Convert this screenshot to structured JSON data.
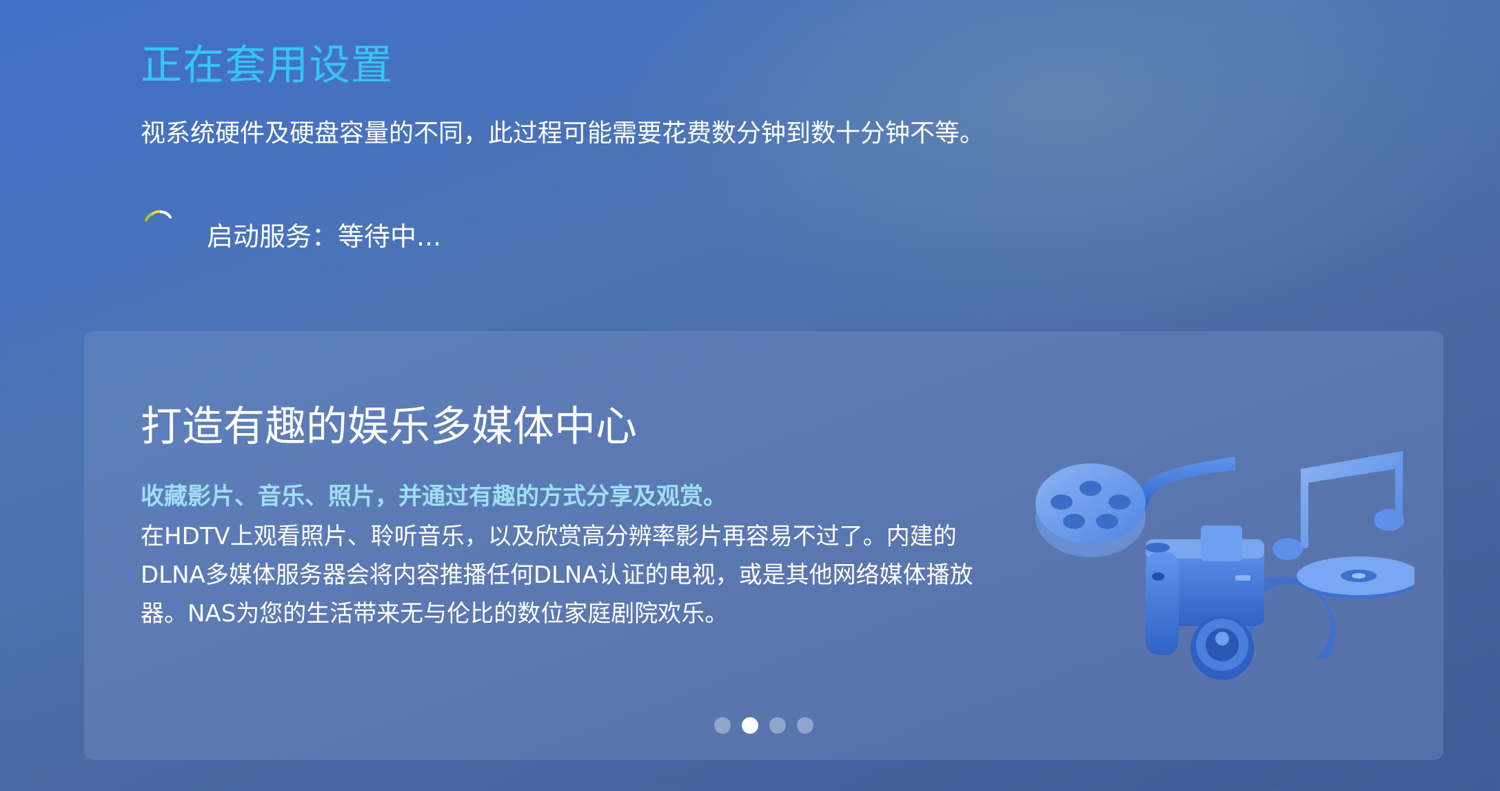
{
  "header": {
    "title": "正在套用设置",
    "description": "视系统硬件及硬盘容量的不同，此过程可能需要花费数分钟到数十分钟不等。"
  },
  "status": {
    "text": "启动服务：等待中...",
    "icon": "loading-spinner-icon"
  },
  "card": {
    "title": "打造有趣的娱乐多媒体中心",
    "subtitle": "收藏影片、音乐、照片，并通过有趣的方式分享及观赏。",
    "body_lines": [
      "在HDTV上观看照片、聆听音乐，以及欣赏高分辨率影片再容易不过了。内建的",
      "DLNA多媒体服务器会将内容推播任何DLNA认证的电视，或是其他网络媒体播放",
      "器。NAS为您的生活带来无与伦比的数位家庭剧院欢乐。"
    ],
    "illustration_icons": [
      "film-reel-icon",
      "camera-icon",
      "music-note-icon",
      "disc-icon"
    ],
    "carousel": {
      "page_count": 4,
      "active_index": 1
    }
  },
  "colors": {
    "title": "#35c6f2",
    "subtitle": "#9ee0f6",
    "background": "#4a6fb8",
    "illustration": "#4a82e0"
  }
}
